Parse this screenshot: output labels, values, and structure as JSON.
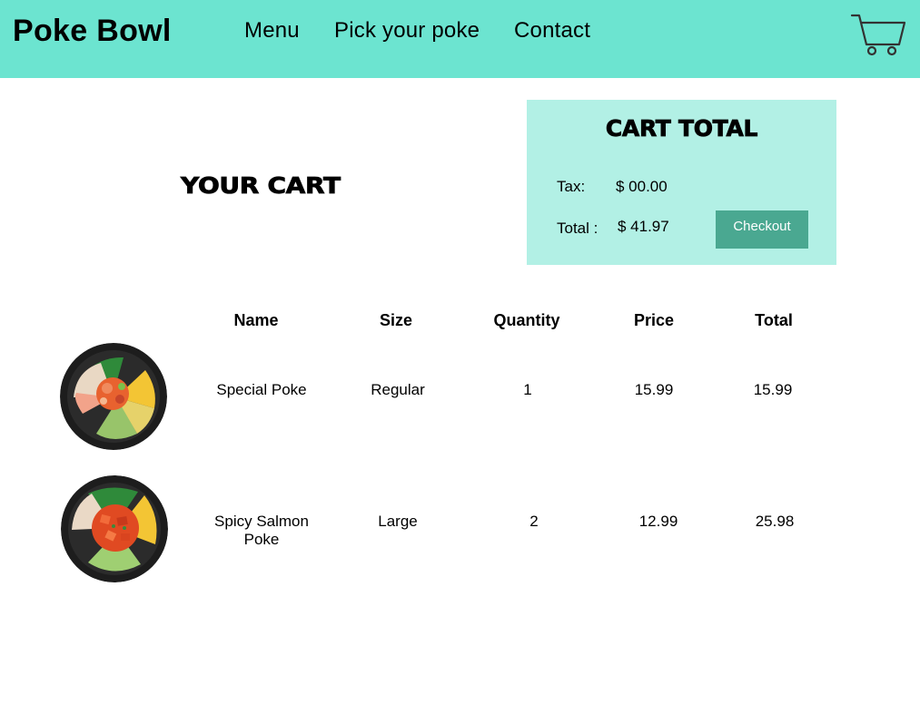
{
  "header": {
    "brand": "Poke Bowl",
    "nav": [
      {
        "label": "Menu"
      },
      {
        "label": "Pick your poke"
      },
      {
        "label": "Contact"
      }
    ],
    "cart_icon": "shopping-cart-icon"
  },
  "page_title": "YOUR CART",
  "summary": {
    "title": "CART TOTAL",
    "tax_label": "Tax:",
    "tax_value": "$ 00.00",
    "total_label": "Total :",
    "total_value": "$ 41.97",
    "checkout_label": "Checkout"
  },
  "table": {
    "columns": [
      "Name",
      "Size",
      "Quantity",
      "Price",
      "Total"
    ],
    "rows": [
      {
        "name": "Special Poke",
        "size": "Regular",
        "quantity": "1",
        "price": "15.99",
        "total": "15.99",
        "image": "poke-bowl-image"
      },
      {
        "name": "Spicy Salmon Poke",
        "size": "Large",
        "quantity": "2",
        "price": "12.99",
        "total": "25.98",
        "image": "salmon-poke-bowl-image"
      }
    ]
  },
  "colors": {
    "header_bg": "#6ce4d0",
    "summary_bg": "#b2f0e5",
    "checkout_bg": "#4aa891"
  }
}
